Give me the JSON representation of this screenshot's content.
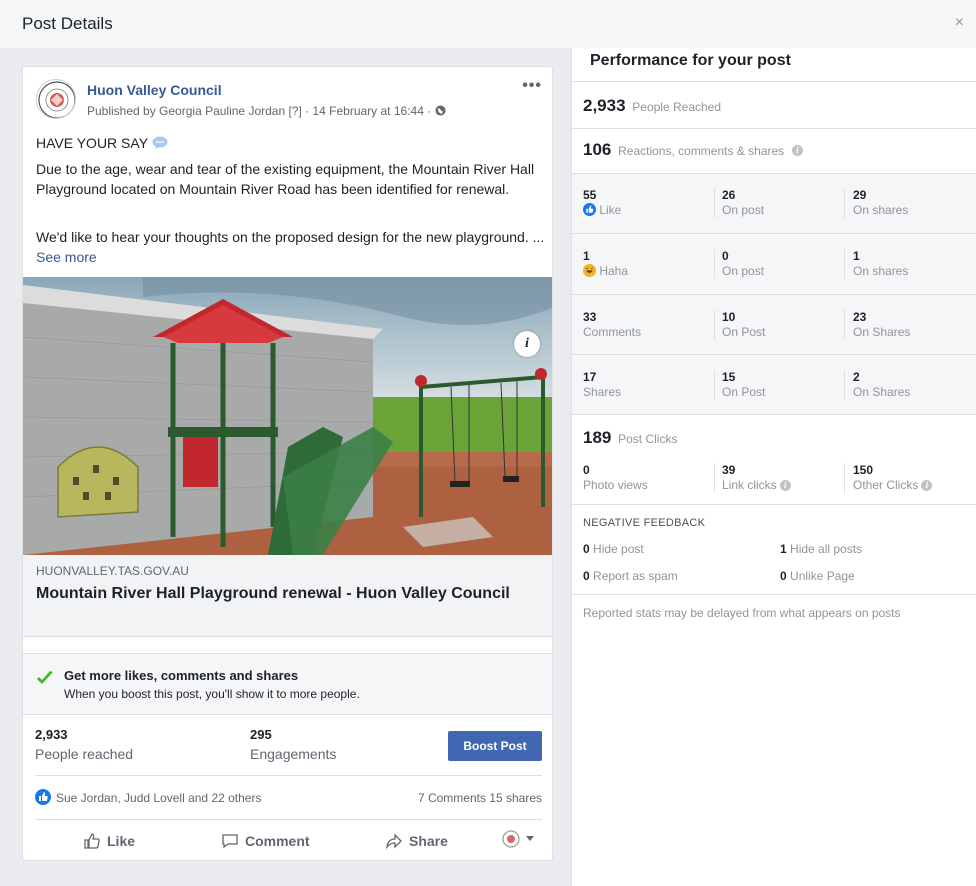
{
  "header": {
    "title": "Post Details",
    "close_glyph": "×"
  },
  "post": {
    "page_name": "Huon Valley Council",
    "meta": "Published by Georgia Pauline Jordan [?] · 14 February at 16:44 ·",
    "more_glyph": "•••",
    "heading": "HAVE YOUR SAY",
    "para1": "Due to the age, wear and tear of the existing equipment, the Mountain River Hall Playground located on Mountain River Road has been identified for renewal.",
    "para2": "We'd like to hear your thoughts on the proposed design for the new playground. ...",
    "see_more": "See more",
    "link_domain": "HUONVALLEY.TAS.GOV.AU",
    "link_title": "Mountain River Hall Playground renewal - Huon Valley Council",
    "info_glyph": "i"
  },
  "boost": {
    "heading": "Get more likes, comments and shares",
    "subtext": "When you boost this post, you'll show it to more people.",
    "reached_value": "2,933",
    "reached_label": "People reached",
    "engagements_value": "295",
    "engagements_label": "Engagements",
    "button_label": "Boost Post"
  },
  "reactions": {
    "names": "Sue Jordan, Judd Lovell and 22 others",
    "counts": "7 Comments  15 shares"
  },
  "actions": {
    "like": "Like",
    "comment": "Comment",
    "share": "Share"
  },
  "performance": {
    "title": "Performance for your post",
    "reached_value": "2,933",
    "reached_label": "People Reached",
    "rcs_value": "106",
    "rcs_label": "Reactions, comments & shares",
    "rows": [
      {
        "total": "55",
        "label": "Like",
        "a_val": "26",
        "a_lab": "On post",
        "b_val": "29",
        "b_lab": "On shares"
      },
      {
        "total": "1",
        "label": "Haha",
        "a_val": "0",
        "a_lab": "On post",
        "b_val": "1",
        "b_lab": "On shares"
      },
      {
        "total": "33",
        "label": "Comments",
        "a_val": "10",
        "a_lab": "On Post",
        "b_val": "23",
        "b_lab": "On Shares"
      },
      {
        "total": "17",
        "label": "Shares",
        "a_val": "15",
        "a_lab": "On Post",
        "b_val": "2",
        "b_lab": "On Shares"
      }
    ],
    "clicks_value": "189",
    "clicks_label": "Post Clicks",
    "clicks": [
      {
        "value": "0",
        "label": "Photo views"
      },
      {
        "value": "39",
        "label": "Link clicks"
      },
      {
        "value": "150",
        "label": "Other Clicks"
      }
    ],
    "negative_heading": "NEGATIVE FEEDBACK",
    "negative": [
      {
        "value": "0",
        "label": "Hide post"
      },
      {
        "value": "1",
        "label": "Hide all posts"
      },
      {
        "value": "0",
        "label": "Report as spam"
      },
      {
        "value": "0",
        "label": "Unlike Page"
      }
    ],
    "note": "Reported stats may be delayed from what appears on posts"
  },
  "colors": {
    "accent": "#4267b2",
    "link": "#365899",
    "like_blue": "#1877f2"
  }
}
